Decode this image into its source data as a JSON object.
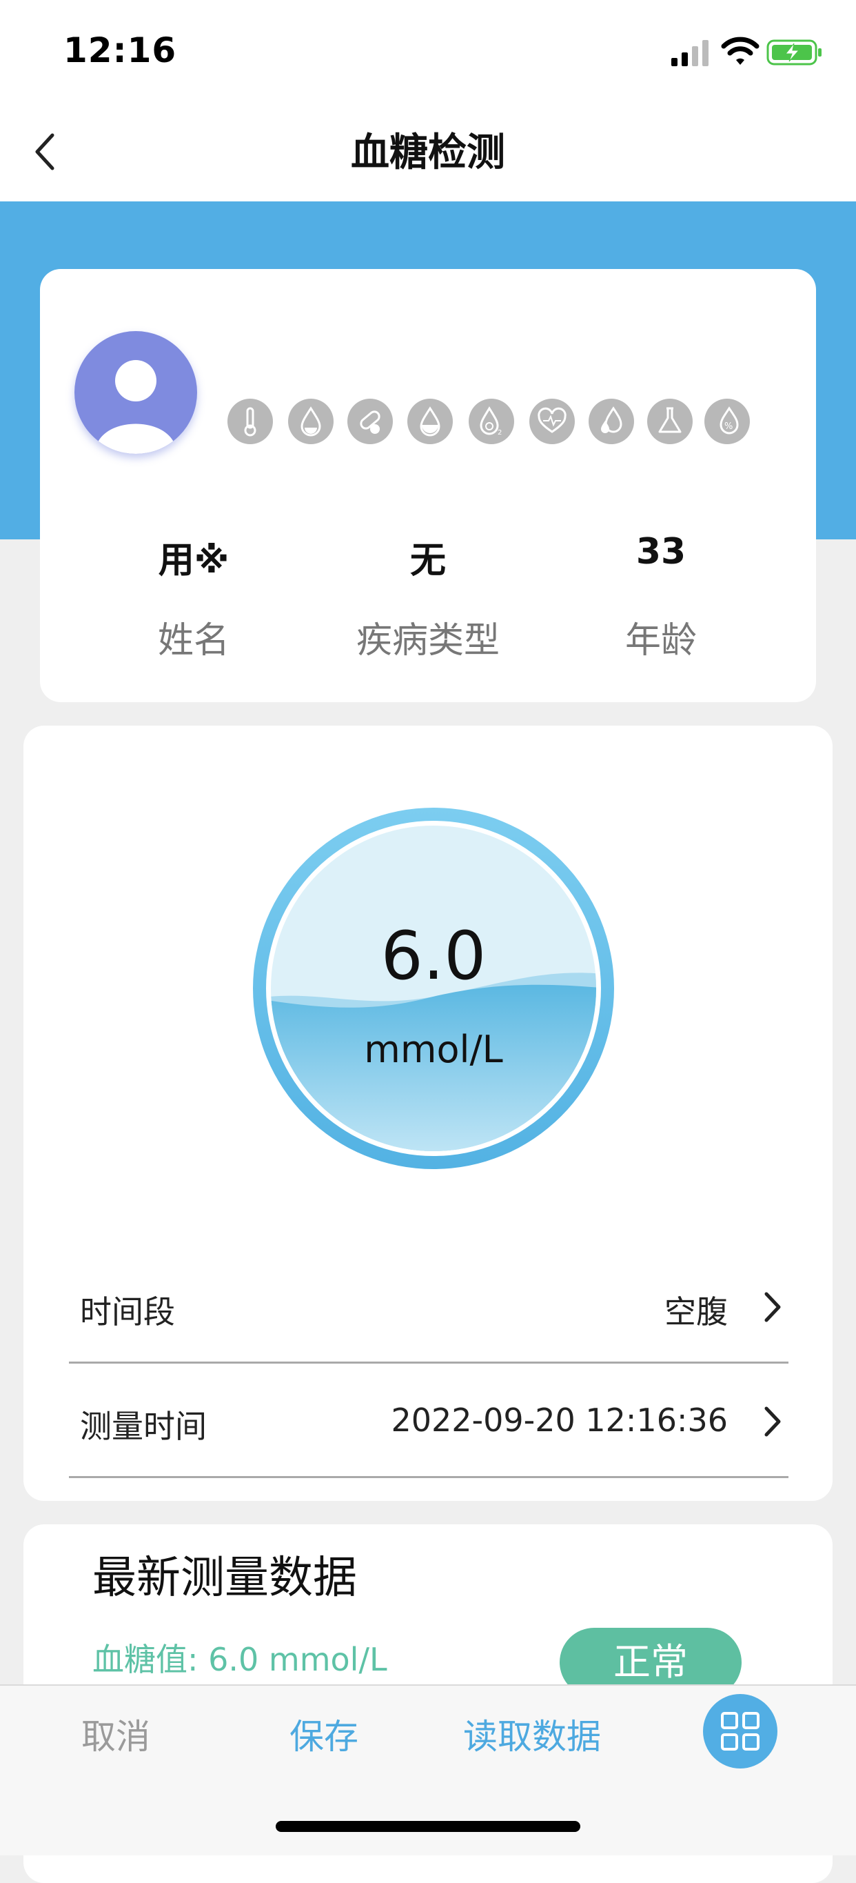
{
  "status_bar": {
    "time": "12:16"
  },
  "nav": {
    "title": "血糖检测"
  },
  "profile": {
    "name": {
      "value": "用※",
      "label": "姓名"
    },
    "disease": {
      "value": "无",
      "label": "疾病类型"
    },
    "age": {
      "value": "33",
      "label": "年龄"
    },
    "feature_icons": [
      "thermometer-icon",
      "blood-drop-icon",
      "pill-icon",
      "water-drop-icon",
      "oxygen-icon",
      "heart-icon",
      "drops-icon",
      "flask-icon",
      "percent-drop-icon"
    ]
  },
  "measurement": {
    "value": "6.0",
    "unit": "mmol/L",
    "period": {
      "label": "时间段",
      "value": "空腹"
    },
    "time": {
      "label": "测量时间",
      "value": "2022-09-20 12:16:36"
    }
  },
  "latest": {
    "title": "最新测量数据",
    "reading": "血糖值: 6.0 mmol/L",
    "status": "正常"
  },
  "toolbar": {
    "cancel": "取消",
    "save": "保存",
    "read": "读取数据"
  },
  "colors": {
    "accent": "#52AEE4",
    "status_green": "#5EBFA1",
    "reading_green": "#5EC2A6",
    "avatar": "#7F8BDF"
  }
}
